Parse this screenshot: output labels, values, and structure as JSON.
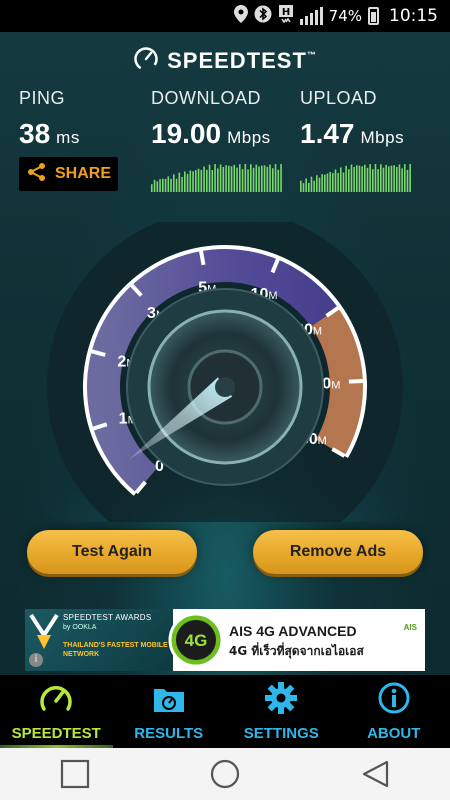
{
  "status_bar": {
    "battery_percent": "74%",
    "time": "10:15",
    "network": "H+"
  },
  "app": {
    "brand": "SPEEDTEST",
    "brand_tm": "™"
  },
  "metrics": {
    "ping": {
      "label": "PING",
      "value": "38",
      "unit": "ms"
    },
    "download": {
      "label": "DOWNLOAD",
      "value": "19.00",
      "unit": "Mbps"
    },
    "upload": {
      "label": "UPLOAD",
      "value": "1.47",
      "unit": "Mbps"
    }
  },
  "share_label": "SHARE",
  "gauge": {
    "ticks": [
      {
        "num": "0",
        "unit": ""
      },
      {
        "num": "1",
        "unit": "M"
      },
      {
        "num": "2",
        "unit": "M"
      },
      {
        "num": "3",
        "unit": "M"
      },
      {
        "num": "5",
        "unit": "M"
      },
      {
        "num": "10",
        "unit": "M"
      },
      {
        "num": "20",
        "unit": "M"
      },
      {
        "num": "30",
        "unit": "M"
      },
      {
        "num": "50",
        "unit": "M"
      }
    ],
    "needle_value_mbps": 0.4
  },
  "buttons": {
    "test_again": "Test Again",
    "remove_ads": "Remove Ads"
  },
  "ad": {
    "award_title": "SPEEDTEST AWARDS",
    "award_by": "by OOKLA",
    "award_text": "THAILAND'S FASTEST MOBILE NETWORK",
    "badge": "4G",
    "title": "AIS 4G ADVANCED",
    "subtitle": "4G ที่เร็วที่สุดจากเอไอเอส",
    "logo": "AIS",
    "info": "i"
  },
  "tabs": [
    {
      "label": "SPEEDTEST",
      "icon": "gauge-icon",
      "active": true
    },
    {
      "label": "RESULTS",
      "icon": "folder-icon",
      "active": false
    },
    {
      "label": "SETTINGS",
      "icon": "gear-icon",
      "active": false
    },
    {
      "label": "ABOUT",
      "icon": "info-icon",
      "active": false
    }
  ],
  "colors": {
    "accent_orange": "#f0a020",
    "tab_blue": "#2fb6ea",
    "tab_active": "#b7e83a",
    "button_gold": "#e7a82a"
  }
}
